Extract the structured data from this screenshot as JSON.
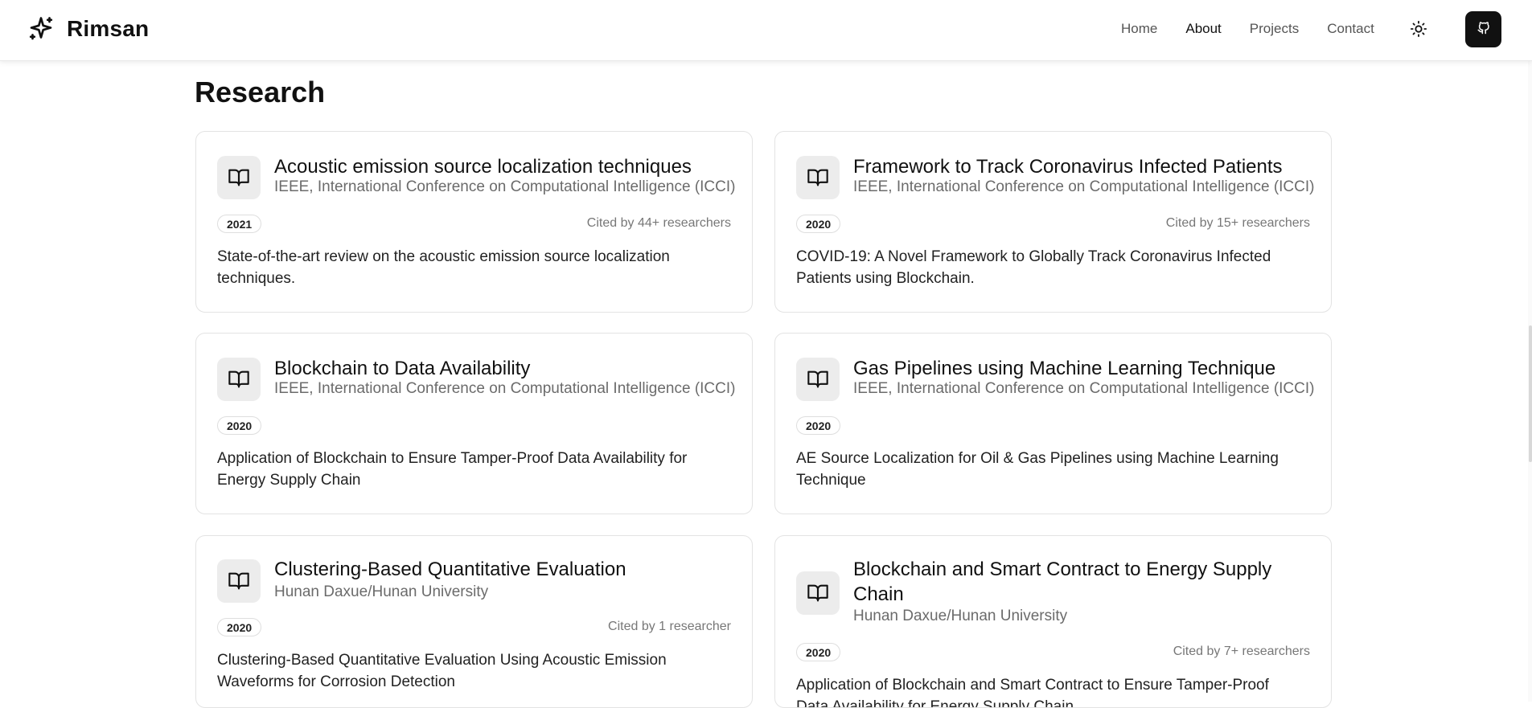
{
  "header": {
    "brand": "Rimsan",
    "nav": [
      {
        "label": "Home"
      },
      {
        "label": "About"
      },
      {
        "label": "Projects"
      },
      {
        "label": "Contact"
      }
    ]
  },
  "section": {
    "title": "Research"
  },
  "cards": [
    {
      "title": "Acoustic emission source localization techniques",
      "venue": "IEEE, International Conference on Computational Intelligence (ICCI)",
      "year": "2021",
      "cited": "Cited by 44+ researchers",
      "description": "State-of-the-art review on the acoustic emission source localization techniques."
    },
    {
      "title": "Framework to Track Coronavirus Infected Patients",
      "venue": "IEEE, International Conference on Computational Intelligence (ICCI)",
      "year": "2020",
      "cited": "Cited by 15+ researchers",
      "description": "COVID-19: A Novel Framework to Globally Track Coronavirus Infected Patients using Blockchain."
    },
    {
      "title": "Blockchain to Data Availability",
      "venue": "IEEE, International Conference on Computational Intelligence (ICCI)",
      "year": "2020",
      "cited": "",
      "description": "Application of Blockchain to Ensure Tamper-Proof Data Availability for Energy Supply Chain"
    },
    {
      "title": "Gas Pipelines using Machine Learning Technique",
      "venue": "IEEE, International Conference on Computational Intelligence (ICCI)",
      "year": "2020",
      "cited": "",
      "description": "AE Source Localization for Oil & Gas Pipelines using Machine Learning Technique"
    },
    {
      "title": "Clustering-Based Quantitative Evaluation",
      "venue": "Hunan Daxue/Hunan University",
      "year": "2020",
      "cited": "Cited by 1 researcher",
      "description": "Clustering-Based Quantitative Evaluation Using Acoustic Emission Waveforms for Corrosion Detection"
    },
    {
      "title": "Blockchain and Smart Contract to Energy Supply Chain",
      "venue": "Hunan Daxue/Hunan University",
      "year": "2020",
      "cited": "Cited by 7+ researchers",
      "description": "Application of Blockchain and Smart Contract to Ensure Tamper-Proof Data Availability for Energy Supply Chain"
    }
  ]
}
